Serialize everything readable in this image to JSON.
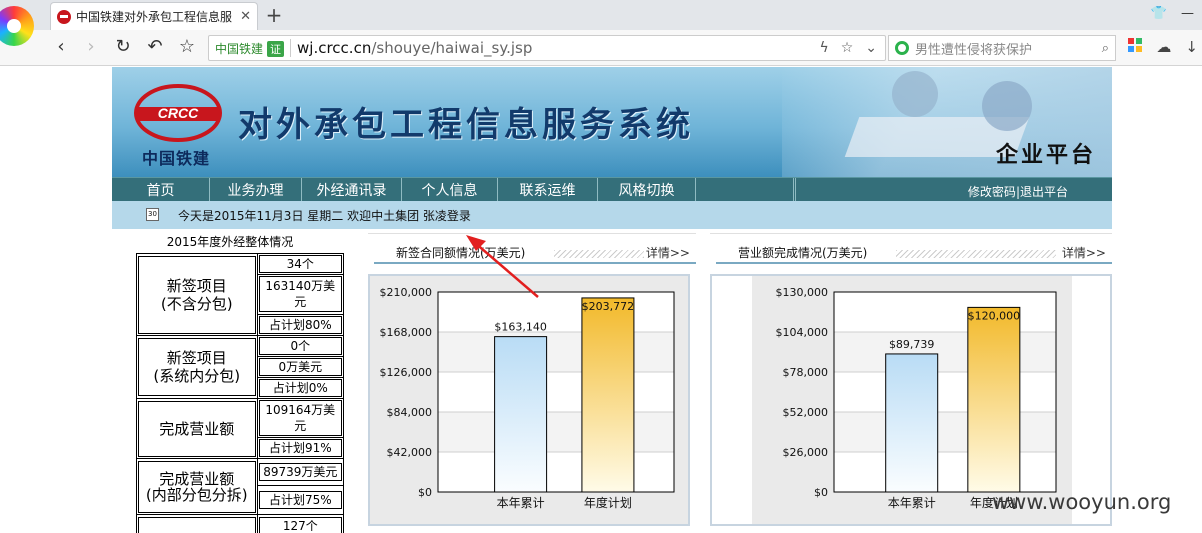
{
  "browser": {
    "tab_title": "中国铁建对外承包工程信息服",
    "new_tab": "+",
    "cert_name": "中国铁建",
    "cert_badge": "证",
    "url_host": "wj.crcc.cn",
    "url_path": "/shouye/haiwai_sy.jsp",
    "search_placeholder": "男性遭性侵将获保护"
  },
  "header": {
    "logo_text": "CRCC",
    "logo_cn": "中国铁建",
    "system_title": "对外承包工程信息服务系统",
    "platform_label": "企业平台"
  },
  "menu": {
    "items": [
      "首页",
      "业务办理",
      "外经通讯录",
      "个人信息",
      "联系运维",
      "风格切换"
    ],
    "change_password": "修改密码",
    "separator": "|",
    "logout": "退出平台"
  },
  "infobar": {
    "text": "今天是2015年11月3日 星期二  欢迎中土集团  张凌登录"
  },
  "summary": {
    "title": "2015年度外经整体情况",
    "rows": [
      {
        "label": "新签项目\n(不含分包)",
        "values": [
          "34个",
          "163140万美元",
          "占计划80%"
        ]
      },
      {
        "label": "新签项目\n(系统内分包)",
        "values": [
          "0个",
          "0万美元",
          "占计划0%"
        ]
      },
      {
        "label": "完成营业额",
        "values": [
          "109164万美元",
          "占计划91%"
        ]
      },
      {
        "label": "完成营业额\n(内部分包分拆)",
        "values": [
          "89739万美元",
          "占计划75%"
        ]
      },
      {
        "label": "",
        "values": [
          "127个"
        ]
      }
    ]
  },
  "charts_panel": {
    "left_title": "新签合同额情况(万美元)",
    "right_title": "营业额完成情况(万美元)",
    "more_label": "详情>>"
  },
  "chart_data": [
    {
      "type": "bar",
      "title": "新签合同额情况(万美元)",
      "categories": [
        "本年累计",
        "年度计划"
      ],
      "values": [
        163140,
        203772
      ],
      "value_labels": [
        "$163,140",
        "$203,772"
      ],
      "ylim": [
        0,
        210000
      ],
      "yticks": [
        "$0",
        "$42,000",
        "$84,000",
        "$126,000",
        "$168,000",
        "$210,000"
      ],
      "bar_colors": [
        "#b9dcf5",
        "#f2b92a"
      ],
      "grid": true
    },
    {
      "type": "bar",
      "title": "营业额完成情况(万美元)",
      "categories": [
        "本年累计",
        "年度计划"
      ],
      "values": [
        89739,
        120000
      ],
      "value_labels": [
        "$89,739",
        "$120,000"
      ],
      "ylim": [
        0,
        130000
      ],
      "yticks": [
        "$0",
        "$26,000",
        "$52,000",
        "$78,000",
        "$104,000",
        "$130,000"
      ],
      "bar_colors": [
        "#b9dcf5",
        "#f2b92a"
      ],
      "grid": true
    }
  ],
  "watermark": "www.wooyun.org"
}
